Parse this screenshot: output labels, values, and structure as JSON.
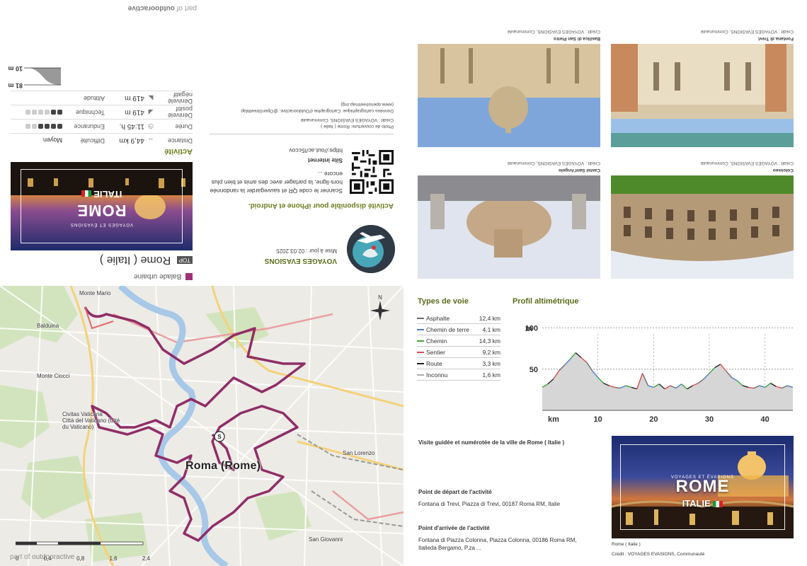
{
  "top_panel": {
    "outdoor_foot_prefix": "part of",
    "outdoor_foot_brand": "outdooractive",
    "activity_type": "Balade urbaine",
    "top_badge": "TOP",
    "title": "Rome ( Italie )",
    "cover": {
      "supertitle": "VOYAGES ET ÉVASIONS",
      "title": "ROME",
      "subtitle": "ITALIE"
    },
    "activite_heading": "Activité",
    "stats": {
      "distance_label": "Distance",
      "distance_value": "44,9 km",
      "difficulty_label": "Difficulté",
      "difficulty_value": "Moyen",
      "duration_label": "Durée",
      "duration_value": "11:45 h.",
      "endurance_label": "Endurance",
      "pos_label": "Dénivelé positif",
      "pos_value": "419 m",
      "technique_label": "Technique",
      "neg_label": "Dénivelé négatif",
      "neg_value": "419 m",
      "altitude_label": "Altitude",
      "alt_max": "81 m",
      "alt_min": "10 m",
      "endurance_level": 4,
      "technique_level": 2
    },
    "vendor_name": "VOYAGES EVASIONS",
    "update_date": "Mise à jour : 02.03.2025",
    "app_heading": "Activité disponible pour iPhone et Android.",
    "scan_text": "Scanner le code QR et sauvegarder la randonnée hors-ligne, la partager avec des amis et bien plus encore ...",
    "site_heading": "Site internet",
    "site_url": "https://out.ac/I5ccov",
    "credit_1": "Photo de couverture: Rome ( Italie )",
    "credit_2": "Crédit : VOYAGES EVASIONS, Communauté",
    "credit_3": "Données cartographique: Cartographie d'Outdooractive; @OpenStreetMap (www.openstreetmap.org)"
  },
  "map": {
    "city_label": "Roma (Rome)",
    "places": [
      "Monte Mario",
      "Balduina",
      "Monte Ciocci",
      "Civitas Vaticana",
      "Città del Vaticano (Cité du Vaticano)",
      "San Lorenzo",
      "San Giovanni"
    ],
    "footer_prefix": "part of",
    "footer_brand": "outdooractive",
    "scale_ticks": [
      "0",
      "0,4",
      "0,8",
      "1,6",
      "2,4"
    ],
    "start_marker": "S"
  },
  "photos": [
    {
      "caption": "Fontana di Trevi",
      "credit": "Crédit : VOYAGES EVASIONS, Communauté"
    },
    {
      "caption": "Basilica di San Pietro",
      "credit": "Crédit : VOYAGES EVASIONS, Communauté"
    },
    {
      "caption": "Colosseo",
      "credit": "Crédit : VOYAGES EVASIONS, Communauté"
    },
    {
      "caption": "Castel Sant'Angelo",
      "credit": "Crédit : VOYAGES EVASIONS, Communauté"
    }
  ],
  "surfaces": {
    "heading": "Types de voie",
    "rows": [
      {
        "name": "Asphalte",
        "km": "12,4 km",
        "color": "#6b6b6b"
      },
      {
        "name": "Chemin de terre",
        "km": "4,1 km",
        "color": "#4a7ecb"
      },
      {
        "name": "Chemin",
        "km": "14,3 km",
        "color": "#3aa33a"
      },
      {
        "name": "Sentier",
        "km": "9,2 km",
        "color": "#e04a4a"
      },
      {
        "name": "Route",
        "km": "3,3 km",
        "color": "#222222"
      },
      {
        "name": "Inconnu",
        "km": "1,6 km",
        "color": "#aaaaaa"
      }
    ]
  },
  "profile": {
    "heading": "Profil altimétrique",
    "y_unit": "m",
    "x_unit": "km",
    "y_ticks": [
      "100",
      "50"
    ],
    "x_ticks": [
      "10",
      "20",
      "30",
      "40"
    ]
  },
  "chart_data": {
    "type": "area",
    "title": "Profil altimétrique",
    "xlabel": "km",
    "ylabel": "m",
    "xlim": [
      0,
      45
    ],
    "ylim": [
      0,
      110
    ],
    "x": [
      0,
      1,
      2,
      3,
      4,
      5,
      6,
      7,
      8,
      9,
      10,
      11,
      12,
      13,
      14,
      15,
      16,
      17,
      18,
      19,
      20,
      21,
      22,
      23,
      24,
      25,
      26,
      27,
      28,
      29,
      30,
      31,
      32,
      33,
      34,
      35,
      36,
      37,
      38,
      39,
      40,
      41,
      42,
      43,
      44,
      45
    ],
    "y": [
      28,
      32,
      38,
      48,
      55,
      62,
      70,
      64,
      58,
      48,
      40,
      33,
      30,
      28,
      27,
      30,
      28,
      26,
      45,
      30,
      28,
      32,
      26,
      30,
      27,
      32,
      26,
      30,
      33,
      38,
      45,
      52,
      56,
      48,
      40,
      36,
      30,
      28,
      27,
      30,
      28,
      33,
      29,
      27,
      30,
      28
    ]
  },
  "description": {
    "line1": "Visite guidée et numérotée de la ville de Rome ( Italie )",
    "start_heading": "Point de départ de l'activité",
    "start_value": "Fontana di Trevi, Piazza di Trevi, 00187 Roma RM, Italie",
    "end_heading": "Point d'arrivée de l'activité",
    "end_value_1": "Fontana di Piazza Colonna, Piazza Colonna, 00186 Roma RM,",
    "end_value_2": "Italieda Bergamo, P.za ..."
  },
  "cover_big": {
    "supertitle": "VOYAGES ET ÉVASIONS",
    "title": "ROME",
    "subtitle": "ITALIE",
    "caption": "Rome ( Italie )",
    "credit": "Crédit : VOYAGES EVASIONS, Communauté"
  }
}
